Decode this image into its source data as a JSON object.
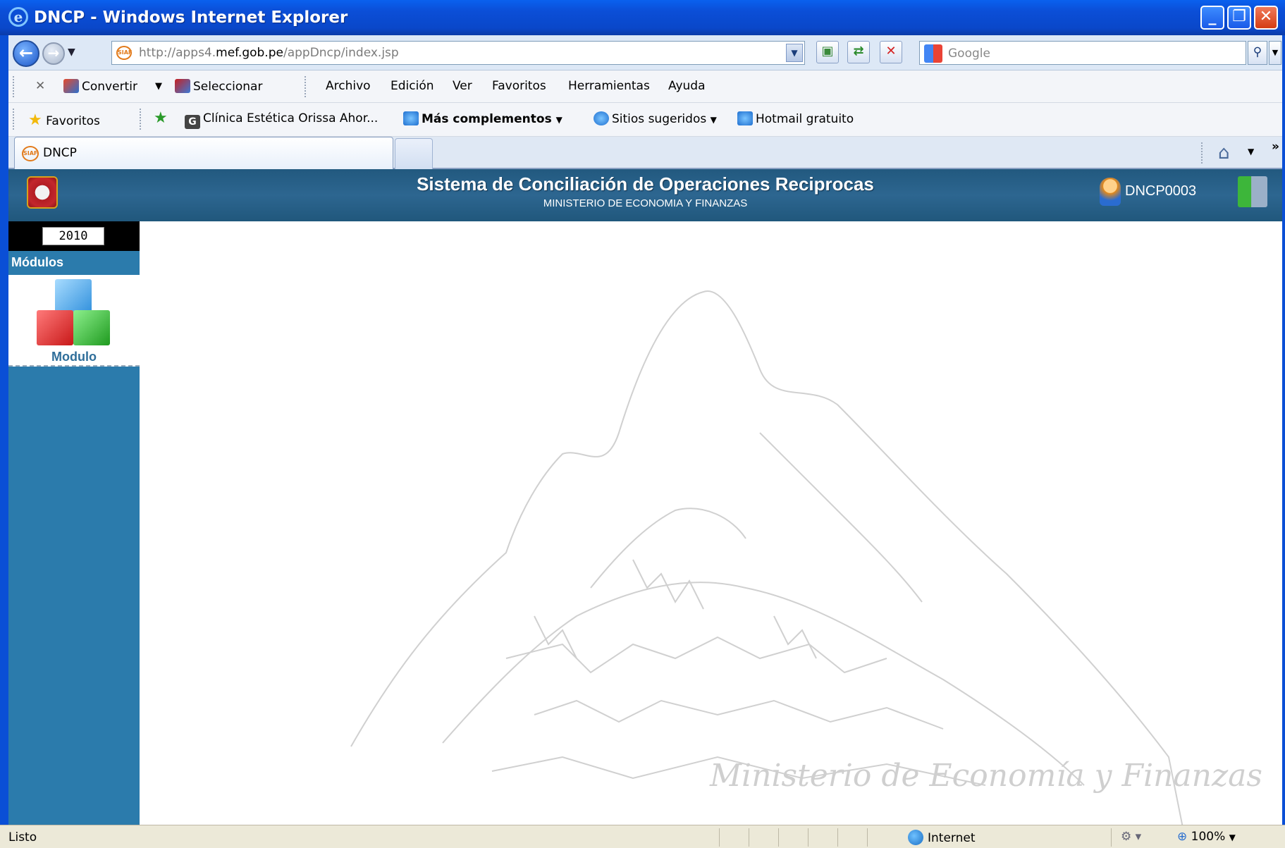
{
  "window": {
    "title": "DNCP - Windows Internet Explorer"
  },
  "address": {
    "url_prefix": "http://apps4.",
    "url_domain": "mef.gob.pe",
    "url_path": "/appDncp/index.jsp",
    "search_placeholder": "Google"
  },
  "toolbar": {
    "convert_label": "Convertir",
    "select_label": "Seleccionar"
  },
  "menu": {
    "items": [
      "Archivo",
      "Edición",
      "Ver",
      "Favoritos",
      "Herramientas",
      "Ayuda"
    ]
  },
  "favorites": {
    "label": "Favoritos",
    "links": [
      "Clínica Estética Orissa  Ahor...",
      "Más complementos",
      "Sitios sugeridos",
      "Hotmail gratuito"
    ]
  },
  "tabs": [
    {
      "label": "DNCP"
    }
  ],
  "header": {
    "title": "Sistema de Conciliación de Operaciones Reciprocas",
    "subtitle": "MINISTERIO DE ECONOMIA Y FINANZAS",
    "user": "DNCP0003"
  },
  "sidebar": {
    "year": "2010",
    "modules_heading": "Módulos",
    "module_label": "Modulo"
  },
  "content": {
    "watermark": "Ministerio de Economía y Finanzas"
  },
  "status": {
    "text": "Listo",
    "zone": "Internet",
    "zoom": "100%"
  },
  "colors": {
    "header_bg": "#2d6690",
    "sidebar_bg": "#2b7bac",
    "titlebar": "#0a4fd6"
  }
}
